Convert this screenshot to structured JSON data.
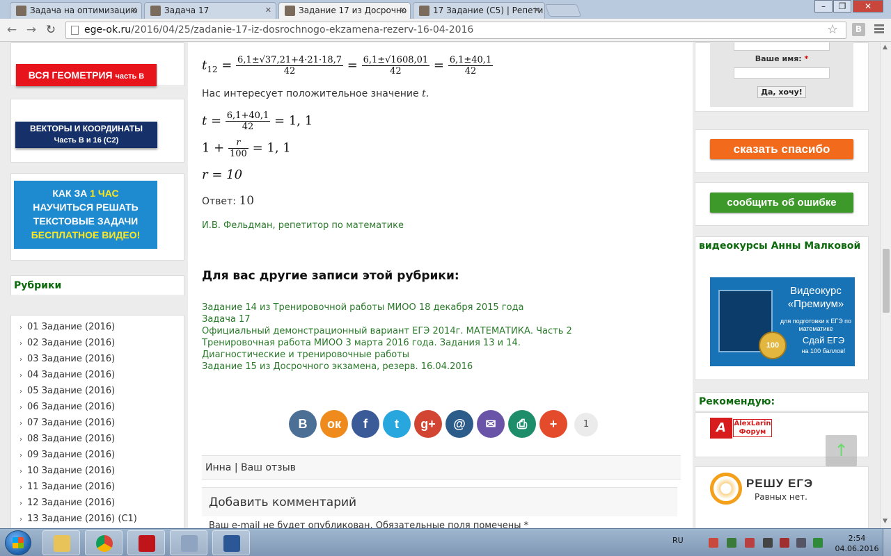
{
  "browser": {
    "tabs": [
      {
        "title": "Задача на оптимизацию",
        "active": false
      },
      {
        "title": "Задача 17",
        "active": false
      },
      {
        "title": "Задание 17 из Досрочно",
        "active": true
      },
      {
        "title": "17 Задание (С5) | Репети",
        "active": false
      }
    ],
    "url_domain": "ege-ok.ru",
    "url_path": "/2016/04/25/zadanie-17-iz-dosrochnogo-ekzamena-rezerv-16-04-2016",
    "ext_label": "B"
  },
  "left_sidebar": {
    "banner_geometry": {
      "main": "ВСЯ ГЕОМЕТРИЯ",
      "sub": "часть B"
    },
    "banner_vectors": {
      "line1": "ВЕКТОРЫ И КООРДИНАТЫ",
      "line2": "Часть В и 16 (С2)"
    },
    "banner_text_tasks": {
      "line1a": "КАК ЗА",
      "line1b": "1 ЧАС",
      "line2": "НАУЧИТЬСЯ РЕШАТЬ",
      "line3": "ТЕКСТОВЫЕ ЗАДАЧИ",
      "line4": "БЕСПЛАТНОЕ ВИДЕО!"
    },
    "rubrics_title": "Рубрики",
    "rubrics": [
      "01 Задание (2016)",
      "02 Задание (2016)",
      "03 Задание (2016)",
      "04 Задание (2016)",
      "05 Задание (2016)",
      "06 Задание (2016)",
      "07 Задание (2016)",
      "08 Задание (2016)",
      "09 Задание (2016)",
      "10 Задание (2016)",
      "11 Задание (2016)",
      "12 Задание (2016)",
      "13 Задание (2016) (С1)"
    ]
  },
  "article": {
    "eq_t12": {
      "lhs": "t",
      "sub": "12",
      "f1_num": "6,1±√37,21+4·21·18,7",
      "f1_den": "42",
      "f2_num": "6,1±√1608,01",
      "f2_den": "42",
      "f3_num": "6,1±40,1",
      "f3_den": "42"
    },
    "text_positive": "Нас интересует положительное значение",
    "text_positive_var": "t",
    "eq_t": {
      "lhs": "t =",
      "num": "6,1+40,1",
      "den": "42",
      "rhs": "= 1, 1"
    },
    "eq_r": {
      "lhs": "1 +",
      "num": "r",
      "den": "100",
      "rhs": "= 1, 1"
    },
    "eq_r10": "r = 10",
    "answer_label": "Ответ:",
    "answer_value": "10",
    "author": "И.В. Фельдман, репетитор по математике",
    "other_heading": "Для вас другие записи этой рубрики:",
    "other_links": [
      "Задание 14 из Тренировочной работы МИОО 18 декабря 2015 года",
      "Задача 17",
      "Официальный демонстрационный вариант ЕГЭ 2014г. МАТЕМАТИКА. Часть 2",
      "Тренировочная работа МИОО 3 марта 2016 года. Задания 13 и 14.",
      "Диагностические и тренировочные работы",
      "Задание 15 из Досрочного экзамена, резерв. 16.04.2016"
    ],
    "share_count": "1",
    "share_buttons": [
      {
        "icon": "vk-icon",
        "glyph": "В",
        "color": "#4b6f95"
      },
      {
        "icon": "odnoklassniki-icon",
        "glyph": "ок",
        "color": "#ef8a1c"
      },
      {
        "icon": "facebook-icon",
        "glyph": "f",
        "color": "#3a5a98"
      },
      {
        "icon": "twitter-icon",
        "glyph": "t",
        "color": "#28a6de"
      },
      {
        "icon": "google-plus-icon",
        "glyph": "g+",
        "color": "#d24532"
      },
      {
        "icon": "mail-ru-icon",
        "glyph": "@",
        "color": "#2b5c8a"
      },
      {
        "icon": "email-icon",
        "glyph": "✉",
        "color": "#6a54a8"
      },
      {
        "icon": "print-icon",
        "glyph": "⎙",
        "color": "#1e8d6a"
      },
      {
        "icon": "more-icon",
        "glyph": "+",
        "color": "#e34b2b"
      }
    ],
    "reply_author": "Инна",
    "reply_sep": "|",
    "reply_label": "Ваш отзыв",
    "add_comment": "Добавить комментарий",
    "email_note": "Ваш e-mail не будет опубликован. Обязательные поля помечены *"
  },
  "right_sidebar": {
    "name_label": "Ваше имя:",
    "required_mark": "*",
    "submit_label": "Да, хочу!",
    "thanks_button": "сказать спасибо",
    "thanks_color": "#f26b1d",
    "report_button": "сообщить об ошибке",
    "report_color": "#3d9a2a",
    "videocourses_title": "видеокурсы Анны Малковой",
    "promo": {
      "title": "Видеокурс «Премиум»",
      "sub": "для подготовки к ЕГЭ по математике",
      "cta": "Сдай ЕГЭ",
      "cta_sub": "на 100 баллов!",
      "seal": "100"
    },
    "recommend_title": "Рекомендую:",
    "larin": {
      "logo": "A",
      "line1": "AlexLarin",
      "line2": "Форум"
    },
    "reshu": {
      "title": "РЕШУ ЕГЭ",
      "slogan": "Равных нет."
    }
  },
  "taskbar": {
    "lang": "RU",
    "time": "2:54",
    "date": "04.06.2016",
    "apps": [
      {
        "icon": "explorer-icon",
        "color": "#e8c35a"
      },
      {
        "icon": "chrome-icon",
        "color": "#3c8b3a"
      },
      {
        "icon": "adobe-reader-icon",
        "color": "#c0141b"
      },
      {
        "icon": "calculator-icon",
        "color": "#8ea4c0"
      },
      {
        "icon": "word-icon",
        "color": "#2b5797"
      }
    ]
  }
}
